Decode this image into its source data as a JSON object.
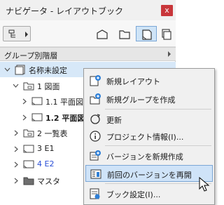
{
  "window": {
    "title": "ナビゲータ - レイアウトブック",
    "close_label": "x"
  },
  "toolbar": {
    "buttons": [
      {
        "name": "project-map-icon"
      },
      {
        "name": "view-map-icon"
      },
      {
        "name": "layout-book-icon",
        "active": true
      },
      {
        "name": "publisher-sets-icon"
      }
    ]
  },
  "group_bar": {
    "label": "グループ別階層"
  },
  "tree": [
    {
      "label": "名称未設定",
      "level": 0,
      "expanded": true,
      "selected": true,
      "icon": "book-icon",
      "style": "normal"
    },
    {
      "label": "1 図面",
      "level": 1,
      "expanded": true,
      "icon": "folder-icon",
      "style": "normal"
    },
    {
      "label": "1.1 平面図",
      "level": 2,
      "expanded": false,
      "icon": "sheet-icon",
      "style": "normal"
    },
    {
      "label": "1.2 平面図",
      "level": 2,
      "expanded": false,
      "icon": "sheet-icon",
      "style": "bold"
    },
    {
      "label": "2 一覧表",
      "level": 1,
      "expanded": false,
      "icon": "folder-icon",
      "style": "normal"
    },
    {
      "label": "3 E1",
      "level": 1,
      "expanded": false,
      "icon": "sheet-icon",
      "style": "normal"
    },
    {
      "label": "4 E2",
      "level": 1,
      "expanded": false,
      "icon": "sheet-icon",
      "style": "blue"
    },
    {
      "label": "マスタ",
      "level": 1,
      "expanded": false,
      "icon": "master-folder-icon",
      "style": "normal"
    }
  ],
  "context_menu": {
    "items": [
      {
        "label": "新規レイアウト",
        "icon": "new-layout-icon"
      },
      {
        "label": "新規グループを作成",
        "icon": "new-group-icon"
      },
      {
        "label": "更新",
        "icon": "refresh-icon"
      },
      {
        "label": "プロジェクト情報(I)...",
        "icon": "info-icon"
      },
      {
        "label": "バージョンを新規作成",
        "icon": "new-version-icon"
      },
      {
        "label": "前回のバージョンを再開",
        "icon": "restore-version-icon",
        "highlighted": true
      },
      {
        "label": "ブック設定(I)...",
        "icon": "book-settings-icon"
      }
    ]
  }
}
